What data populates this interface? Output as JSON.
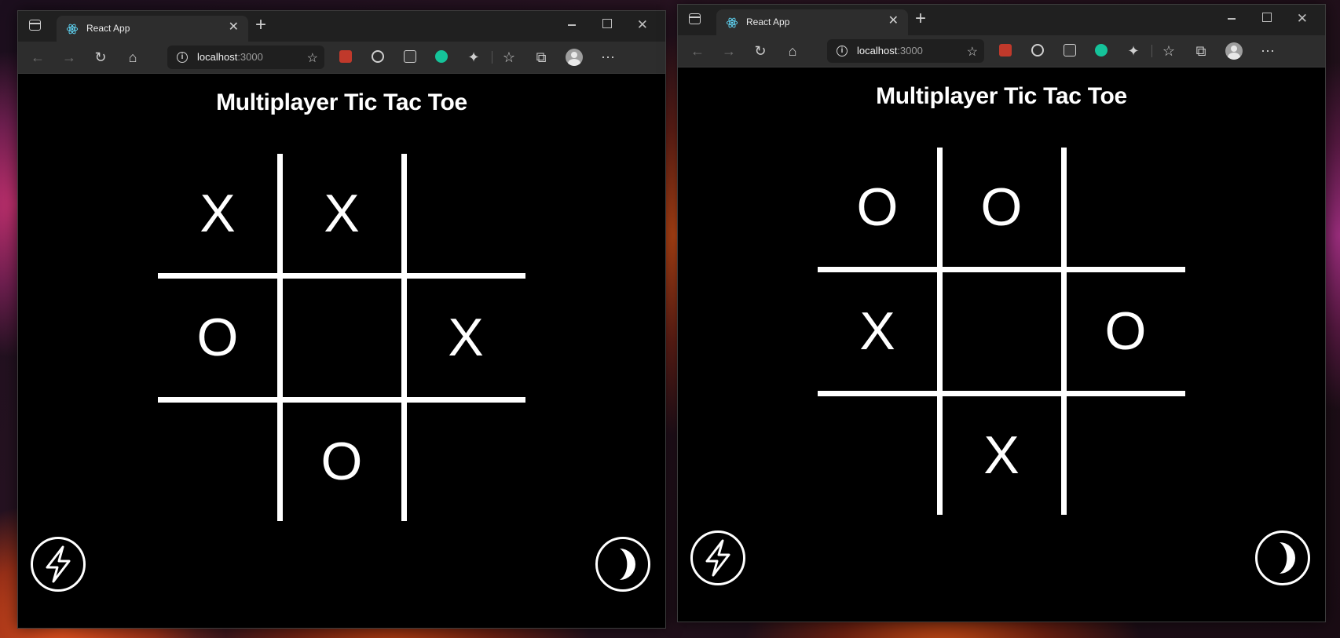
{
  "windows": [
    {
      "tab": {
        "title": "React App"
      },
      "address": {
        "host": "localhost",
        "port": ":3000"
      },
      "page": {
        "title": "Multiplayer Tic Tac Toe",
        "board": [
          "X",
          "X",
          "",
          "O",
          "",
          "X",
          "",
          "O",
          ""
        ]
      }
    },
    {
      "tab": {
        "title": "React App"
      },
      "address": {
        "host": "localhost",
        "port": ":3000"
      },
      "page": {
        "title": "Multiplayer Tic Tac Toe",
        "board": [
          "O",
          "O",
          "",
          "X",
          "",
          "O",
          "",
          "X",
          ""
        ]
      }
    }
  ],
  "icons": {
    "left_button": "lightning-icon",
    "right_button": "moon-icon"
  },
  "colors": {
    "page_bg": "#000000",
    "grid": "#ffffff",
    "tab_bar": "#202020",
    "toolbar": "#2d2d2d"
  }
}
